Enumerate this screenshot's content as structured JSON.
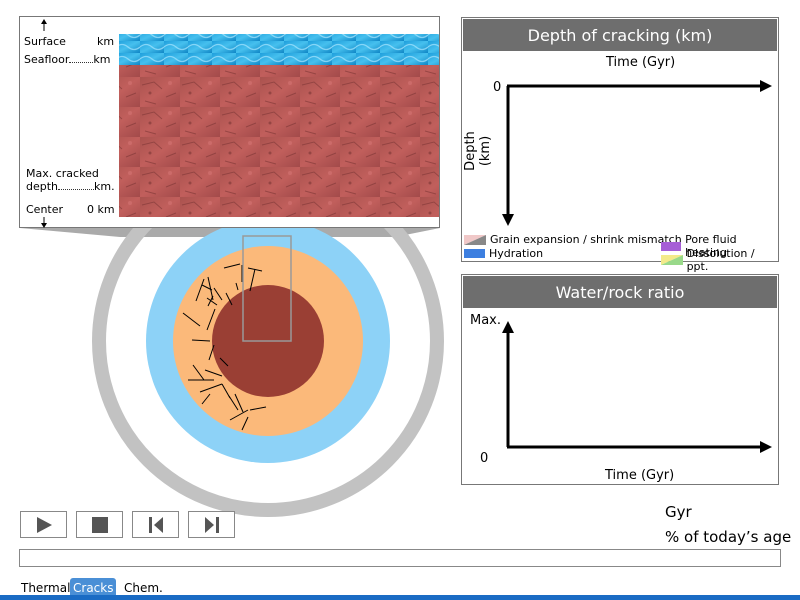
{
  "layers_panel": {
    "surface_label": "Surface",
    "surface_unit": "km",
    "seafloor_label": "Seafloor",
    "seafloor_unit": "km",
    "cracked_label_1": "Max. cracked",
    "cracked_label_2": "depth",
    "cracked_unit": "km.",
    "center_label": "Center",
    "center_value": "0 km"
  },
  "depth_chart": {
    "title": "Depth of cracking (km)",
    "xlabel": "Time (Gyr)",
    "ylabel": "Depth (km)",
    "origin_label": "0"
  },
  "legend": {
    "items": [
      {
        "label": "Grain expansion / shrink mismatch",
        "icon": "grain-swatch-icon"
      },
      {
        "label": "Pore fluid heating",
        "icon": "pore-swatch-icon"
      },
      {
        "label": "Hydration",
        "icon": "hydration-swatch-icon"
      },
      {
        "label": "Dissolution / ppt.",
        "icon": "dissolution-swatch-icon"
      }
    ]
  },
  "water_chart": {
    "title": "Water/rock ratio",
    "ymax_label": "Max.",
    "origin_label": "0",
    "xlabel": "Time (Gyr)"
  },
  "status": {
    "gyr_label": "Gyr",
    "age_label": "% of today’s age"
  },
  "controls": {
    "play": "play-icon",
    "stop": "stop-icon",
    "step_back": "step-back-icon",
    "step_forward": "step-forward-icon"
  },
  "tabs": [
    {
      "label": "Thermal",
      "active": false
    },
    {
      "label": "Cracks",
      "active": true
    },
    {
      "label": "Chem.",
      "active": false
    }
  ],
  "colors": {
    "ice": "#8dd2f7",
    "mantle": "#fbb97a",
    "core": "#9a3f34",
    "outer_ring": "#c2c2c2",
    "title_bar": "#6e6e6e",
    "tab_active": "#4a8fd6"
  }
}
